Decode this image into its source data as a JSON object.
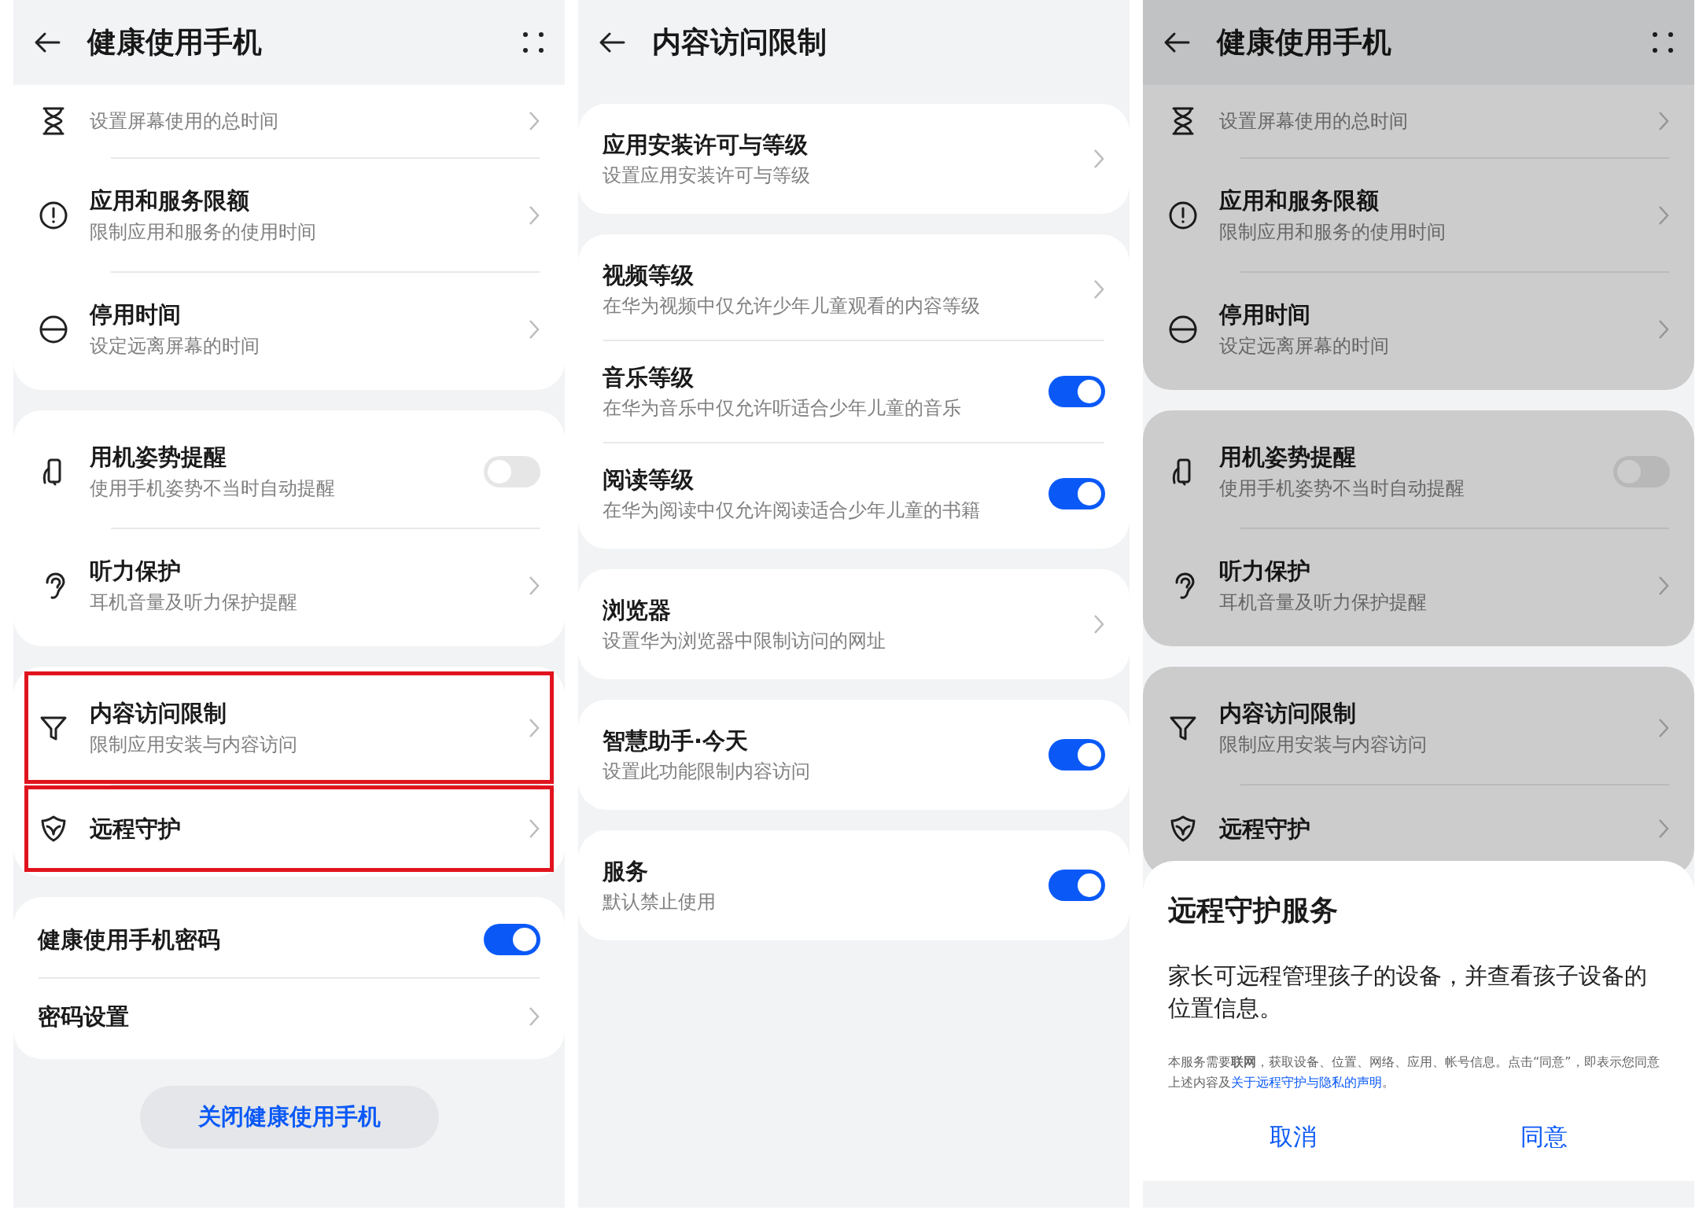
{
  "panels": [
    {
      "title": "健康使用手机",
      "back": true,
      "more": true,
      "scrolled": true,
      "dimmed": false,
      "groups": [
        {
          "items": [
            {
              "kind": "icon_nav",
              "subtitle": "设置屏幕使用的总时间",
              "highlighted": false
            },
            {
              "kind": "icon_nav",
              "title": "应用和服务限额",
              "subtitle": "限制应用和服务的使用时间",
              "highlighted": false
            },
            {
              "kind": "icon_nav",
              "title": "停用时间",
              "subtitle": "设定远离屏幕的时间",
              "highlighted": false
            }
          ]
        },
        {
          "items": [
            {
              "kind": "icon_toggle",
              "title": "用机姿势提醒",
              "subtitle": "使用手机姿势不当时自动提醒",
              "on": false,
              "highlighted": false
            },
            {
              "kind": "icon_nav",
              "title": "听力保护",
              "subtitle": "耳机音量及听力保护提醒",
              "highlighted": false
            }
          ]
        },
        {
          "items": [
            {
              "kind": "icon_nav",
              "title": "内容访问限制",
              "subtitle": "限制应用安装与内容访问",
              "highlighted": true
            },
            {
              "kind": "icon_nav",
              "title": "远程守护",
              "highlighted": true
            }
          ]
        },
        {
          "items": [
            {
              "kind": "toggle",
              "title": "健康使用手机密码",
              "on": true,
              "highlighted": false
            },
            {
              "kind": "nav",
              "title": "密码设置",
              "highlighted": false
            }
          ]
        }
      ],
      "footer_button": "关闭健康使用手机"
    },
    {
      "title": "内容访问限制",
      "back": true,
      "more": false,
      "scrolled": false,
      "dimmed": false,
      "groups": [
        {
          "items": [
            {
              "kind": "nav",
              "title": "应用安装许可与等级",
              "subtitle": "设置应用安装许可与等级",
              "highlighted": false
            }
          ]
        },
        {
          "items": [
            {
              "kind": "nav",
              "title": "视频等级",
              "subtitle": "在华为视频中仅允许少年儿童观看的内容等级",
              "highlighted": false
            },
            {
              "kind": "toggle",
              "title": "音乐等级",
              "subtitle": "在华为音乐中仅允许听适合少年儿童的音乐",
              "on": true,
              "highlighted": false
            },
            {
              "kind": "toggle",
              "title": "阅读等级",
              "subtitle": "在华为阅读中仅允许阅读适合少年儿童的书籍",
              "on": true,
              "highlighted": false
            }
          ]
        },
        {
          "items": [
            {
              "kind": "nav",
              "title": "浏览器",
              "subtitle": "设置华为浏览器中限制访问的网址",
              "highlighted": false
            }
          ]
        },
        {
          "items": [
            {
              "kind": "toggle",
              "title": "智慧助手·今天",
              "subtitle": "设置此功能限制内容访问",
              "on": true,
              "highlighted": false
            }
          ]
        },
        {
          "items": [
            {
              "kind": "toggle",
              "title": "服务",
              "subtitle": "默认禁止使用",
              "on": true,
              "highlighted": false
            }
          ]
        }
      ]
    },
    {
      "title": "健康使用手机",
      "back": true,
      "more": true,
      "scrolled": true,
      "dimmed": true,
      "groups": [
        {
          "items": [
            {
              "kind": "icon_nav",
              "subtitle": "设置屏幕使用的总时间",
              "highlighted": false
            },
            {
              "kind": "icon_nav",
              "title": "应用和服务限额",
              "subtitle": "限制应用和服务的使用时间",
              "highlighted": false
            },
            {
              "kind": "icon_nav",
              "title": "停用时间",
              "subtitle": "设定远离屏幕的时间",
              "highlighted": false
            }
          ]
        },
        {
          "items": [
            {
              "kind": "icon_toggle",
              "title": "用机姿势提醒",
              "subtitle": "使用手机姿势不当时自动提醒",
              "on": false,
              "highlighted": false
            },
            {
              "kind": "icon_nav",
              "title": "听力保护",
              "subtitle": "耳机音量及听力保护提醒",
              "highlighted": false
            }
          ]
        },
        {
          "items": [
            {
              "kind": "icon_nav",
              "title": "内容访问限制",
              "subtitle": "限制应用安装与内容访问",
              "highlighted": false
            },
            {
              "kind": "icon_nav",
              "title": "远程守护",
              "highlighted": false
            }
          ]
        }
      ],
      "dialog": {
        "title": "远程守护服务",
        "body": "家长可远程管理孩子的设备，并查看孩子设备的位置信息。",
        "note": "本服务需要**联网**，获取设备、位置、网络、应用、帐号信息。点击“同意”，即表示您同意上述内容及",
        "note_link": "关于远程守护与隐私的声明",
        "note_end": "。",
        "buttons": [
          "取消",
          "同意"
        ]
      }
    }
  ]
}
